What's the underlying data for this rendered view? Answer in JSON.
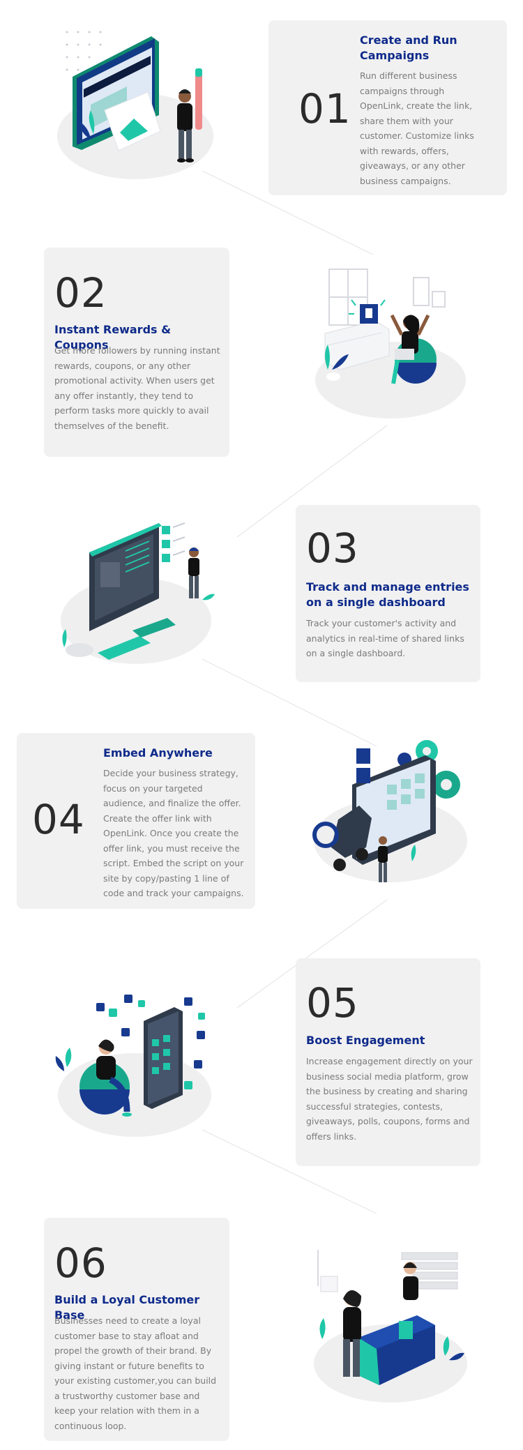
{
  "steps": [
    {
      "number": "01",
      "title": "Create and Run Campaigns",
      "description": "Run different business campaigns through OpenLink, create the link, share them with your customer. Customize links with rewards, offers, giveaways, or any other business campaigns.",
      "illustration": "campaign-illustration"
    },
    {
      "number": "02",
      "title": "Instant Rewards & Coupons",
      "description": "Get more followers by running instant rewards, coupons, or any other promotional activity. When users get any offer instantly, they tend to perform tasks more quickly to avail themselves of the benefit.",
      "illustration": "rewards-illustration"
    },
    {
      "number": "03",
      "title": "Track and manage entries on a single dashboard",
      "description": "Track your customer's activity and analytics in real-time of shared links on a single dashboard.",
      "illustration": "dashboard-illustration"
    },
    {
      "number": "04",
      "title": "Embed Anywhere",
      "description": "Decide your business strategy, focus on your targeted audience, and finalize the offer. Create the offer link with OpenLink. Once you create the offer link, you must receive the script. Embed the script on your site by copy/pasting 1 line of code and track your campaigns.",
      "illustration": "embed-illustration"
    },
    {
      "number": "05",
      "title": "Boost Engagement",
      "description": "Increase engagement directly on your business social media platform, grow the business by creating and sharing successful strategies, contests, giveaways, polls, coupons, forms and offers links.",
      "illustration": "engagement-illustration"
    },
    {
      "number": "06",
      "title": "Build a Loyal Customer Base",
      "description": "Businesses need to create a loyal customer base to stay afloat and propel the growth of their brand. By giving instant or future benefits to your existing customer,you can build a trustworthy customer base and keep your relation with them in a continuous loop.",
      "illustration": "customer-base-illustration"
    }
  ],
  "colors": {
    "card_bg": "#f1f1f1",
    "title": "#0e2a8a",
    "number": "#2b2b2b",
    "text": "#7a7a7a",
    "accent_teal": "#1fc7a8",
    "accent_navy": "#173a8f"
  }
}
